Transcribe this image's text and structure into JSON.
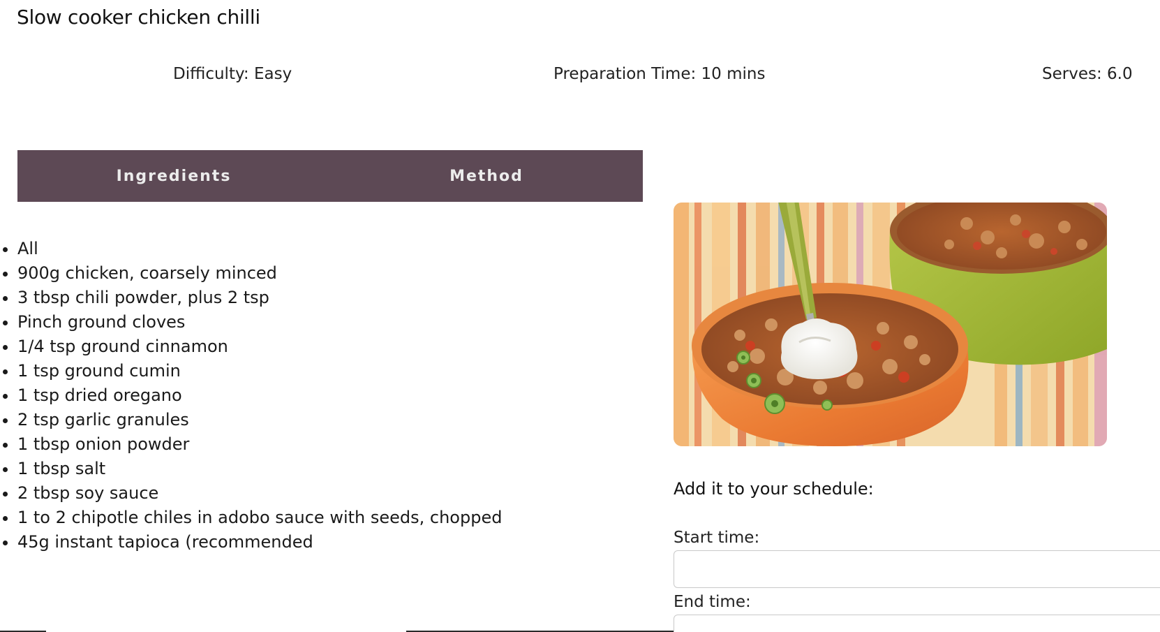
{
  "recipe": {
    "title": "Slow cooker chicken chilli",
    "difficulty": "Difficulty: Easy",
    "prep_time": "Preparation Time: 10 mins",
    "serves": "Serves: 6.0"
  },
  "tabs": [
    {
      "label": "Ingredients"
    },
    {
      "label": "Method"
    }
  ],
  "ingredients": [
    "All",
    "900g chicken, coarsely minced",
    "3 tbsp chili powder, plus 2 tsp",
    "Pinch ground cloves",
    "1/4 tsp ground cinnamon",
    "1 tsp ground cumin",
    "1 tsp dried oregano",
    "2 tsp garlic granules",
    "1 tbsp onion powder",
    "1 tbsp salt",
    "2 tbsp soy sauce",
    "1 to 2 chipotle chiles in adobo sauce with seeds, chopped",
    "45g instant tapioca (recommended"
  ],
  "schedule": {
    "heading": "Add it to your schedule:",
    "start_label": "Start time:",
    "start_value": "",
    "end_label": "End time:",
    "end_value": ""
  },
  "colors": {
    "tab_bar": "#5d4955",
    "tab_text": "#ececec"
  }
}
